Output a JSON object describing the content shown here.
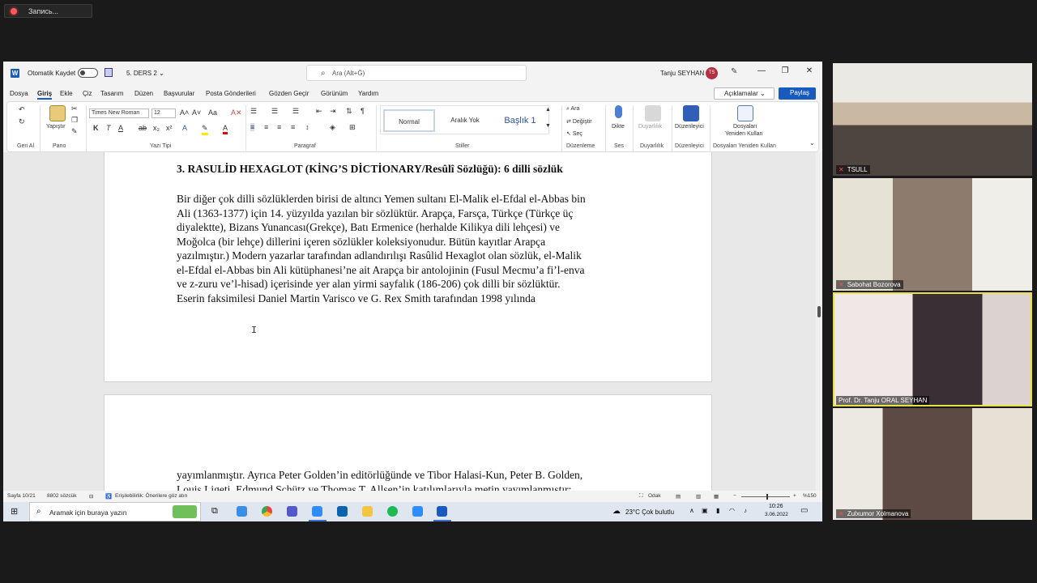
{
  "recording": {
    "label": "Запись..."
  },
  "word": {
    "autosave_label": "Otomatik Kaydet",
    "doc_name": "5. DERS 2 ⌄",
    "search_placeholder": "Ara (Alt+Ğ)",
    "user_name": "Tanju SEYHAN",
    "user_initials": "TS",
    "window_controls": [
      "—",
      "❐",
      "✕"
    ],
    "menu": [
      "Dosya",
      "Giriş",
      "Ekle",
      "Çiz",
      "Tasarım",
      "Düzen",
      "Başvurular",
      "Posta Gönderileri",
      "Gözden Geçir",
      "Görünüm",
      "Yardım"
    ],
    "active_menu": "Giriş",
    "comments_label": "Açıklamalar",
    "share_label": "Paylaş",
    "ribbon": {
      "undo_group": "Geri Al",
      "paste_label": "Yapıştır",
      "clipboard_group": "Pano",
      "font_name": "Times New Roman",
      "font_size": "12",
      "font_group": "Yazı Tipi",
      "paragraph_group": "Paragraf",
      "styles": [
        "Normal",
        "Aralık Yok",
        "Başlık 1"
      ],
      "styles_group": "Stiller",
      "find_label": "Ara",
      "replace_label": "Değiştir",
      "select_label": "Seç",
      "editing_group": "Düzenleme",
      "dictate_label": "Dikte",
      "voice_group": "Ses",
      "sensitivity_label": "Duyarlılık",
      "sensitivity_group": "Duyarlılık",
      "editor_label": "Düzenleyici",
      "editor_group": "Düzenleyici",
      "reuse_label_1": "Dosyaları",
      "reuse_label_2": "Yeniden Kullan",
      "reuse_group": "Dosyaları Yeniden Kullan"
    },
    "document": {
      "heading": "3. RASULİD HEXAGLOT (KİNG’S DİCTİONARY/Resûlî Sözlüğü): 6 dilli sözlük",
      "paragraph_lines": [
        "Bir diğer çok dilli sözlüklerden birisi de altıncı Yemen sultanı El-Malik el-Efdal el-Abbas bin",
        "Ali (1363-1377) için 14. yüzyılda yazılan bir sözlüktür. Arapça, Farsça, Türkçe (Türkçe üç",
        "diyalektte), Bizans Yunancası(Grekçe), Batı Ermenice (herhalde Kilikya dili lehçesi) ve",
        "Moğolca (bir lehçe) dillerini içeren sözlükler koleksiyonudur. Bütün kayıtlar Arapça",
        "yazılmıştır.) Modern yazarlar tarafından adlandırılışı Rasûlid Hexaglot olan sözlük, el-Malik",
        "el-Efdal el-Abbas bin Ali kütüphanesi’ne ait Arapça bir antolojinin (Fusul Mecmu’a fi’l-enva",
        "ve z-zuru ve’l-hisad) içerisinde yer alan yirmi sayfalık (186-206) çok dilli bir sözlüktür.",
        "Eserin faksimilesi Daniel Martin Varisco ve G. Rex Smith tarafından 1998 yılında"
      ],
      "page2_lines": [
        "yayımlanmıştır. Ayrıca  Peter Golden’in editörlüğünde ve Tibor Halasi-Kun, Peter B. Golden,",
        "Louis Ligeti, Edmund Schütz ve Thomas T. Allsen’in katılımlarıyla metin yayımlanmıştır:"
      ]
    },
    "status": {
      "page": "Sayfa 10/21",
      "words": "8802 sözcük",
      "accessibility": "Erişilebilirlik: Önerilere göz atın",
      "focus": "Odak",
      "zoom_minus": "−",
      "zoom_plus": "+",
      "zoom": "%150"
    }
  },
  "taskbar": {
    "search_placeholder": "Aramak için buraya yazın",
    "weather": "23°C  Çok bulutlu",
    "time": "10:26",
    "date": "3.06.2022"
  },
  "participants": [
    {
      "name": "TSULL"
    },
    {
      "name": "Sabohat Bozorova"
    },
    {
      "name": "Prof. Dr. Tanju ORAL SEYHAN"
    },
    {
      "name": "Zulxumor Xolmanova"
    }
  ]
}
